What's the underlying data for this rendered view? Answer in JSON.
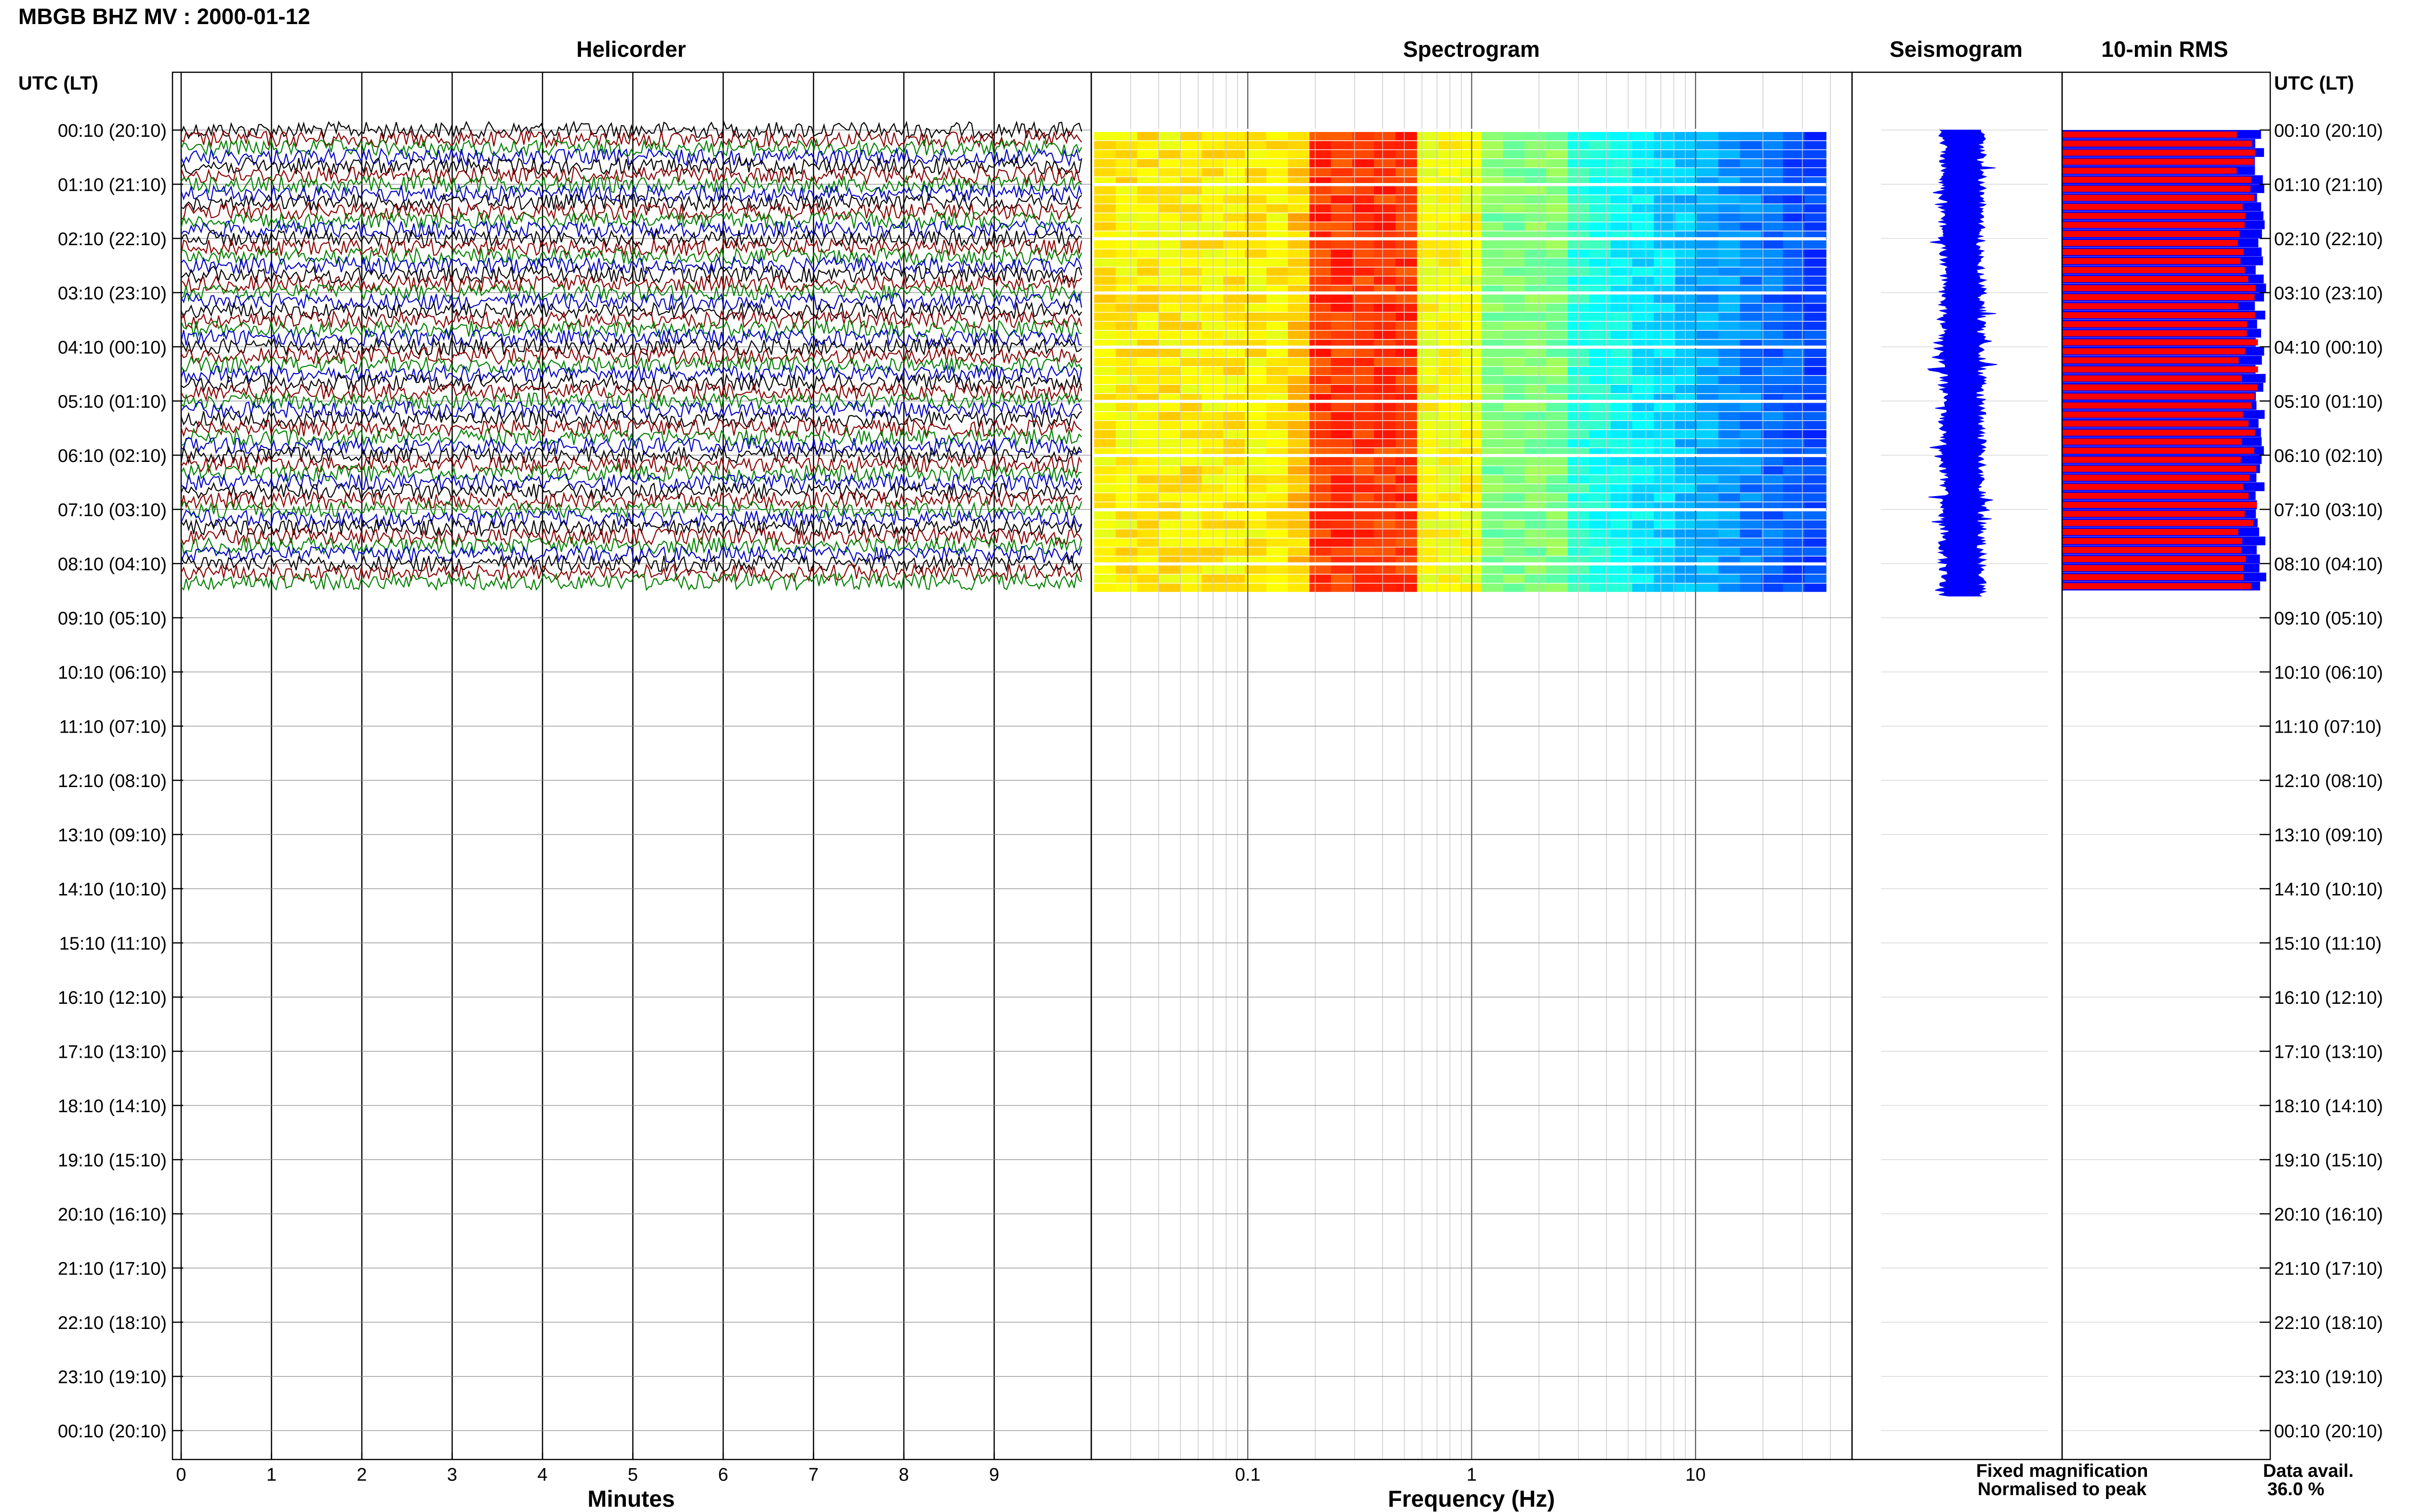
{
  "header": {
    "station_title": "MBGB BHZ MV : 2000-01-12"
  },
  "panels": {
    "helicorder_title": "Helicorder",
    "spectrogram_title": "Spectrogram",
    "seismogram_title": "Seismogram",
    "rms_title": "10-min RMS"
  },
  "axes": {
    "left_axis_label": "UTC (LT)",
    "right_axis_label": "UTC (LT)",
    "minutes_label": "Minutes",
    "frequency_label": "Frequency (Hz)"
  },
  "legend": {
    "fixed_label": "Fixed magnification",
    "fixed_color": "#0000ff",
    "normalised_label": "Normalised to peak",
    "normalised_color": "#ff0000"
  },
  "availability": {
    "label": "Data avail.",
    "value": "36.0 %"
  },
  "chart_data": {
    "type": "helicorder",
    "hour_labels": [
      "00:10 (20:10)",
      "01:10 (21:10)",
      "02:10 (22:10)",
      "03:10 (23:10)",
      "04:10 (00:10)",
      "05:10 (01:10)",
      "06:10 (02:10)",
      "07:10 (03:10)",
      "08:10 (04:10)",
      "09:10 (05:10)",
      "10:10 (06:10)",
      "11:10 (07:10)",
      "12:10 (08:10)",
      "13:10 (09:10)",
      "14:10 (10:10)",
      "15:10 (11:10)",
      "16:10 (12:10)",
      "17:10 (13:10)",
      "18:10 (14:10)",
      "19:10 (15:10)",
      "20:10 (16:10)",
      "21:10 (17:10)",
      "22:10 (18:10)",
      "23:10 (19:10)",
      "00:10 (20:10)"
    ],
    "minute_ticks": [
      "0",
      "1",
      "2",
      "3",
      "4",
      "5",
      "6",
      "7",
      "8",
      "9"
    ],
    "minute_range": [
      0,
      10
    ],
    "frequency_ticks": [
      "0.1",
      "1",
      "10"
    ],
    "frequency_range": [
      0.02,
      50
    ],
    "frequency_scale": "log",
    "data_hours": 8.6,
    "trace_colors": [
      "#000000",
      "#8b0000",
      "#008000",
      "#0000c8"
    ],
    "spectrogram_colormap": "jet",
    "seismogram_color": "#0000ff",
    "rms_fixed_color": "#0000ff",
    "rms_normalised_color": "#ff0000"
  }
}
